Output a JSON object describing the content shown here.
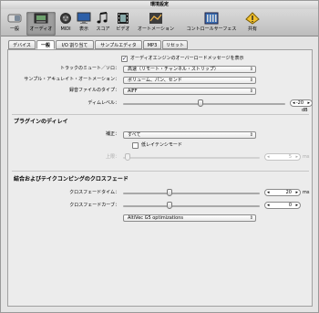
{
  "window": {
    "title": "環境設定"
  },
  "toolbar": {
    "items": [
      {
        "label": "一般",
        "icon": "switch-icon"
      },
      {
        "label": "オーディオ",
        "icon": "audio-interface-icon"
      },
      {
        "label": "MIDI",
        "icon": "midi-port-icon"
      },
      {
        "label": "表示",
        "icon": "display-icon"
      },
      {
        "label": "スコア",
        "icon": "notes-icon"
      },
      {
        "label": "ビデオ",
        "icon": "film-icon"
      },
      {
        "label": "オートメーション",
        "icon": "automation-icon"
      },
      {
        "label": "コントロールサーフェス",
        "icon": "control-surface-icon"
      },
      {
        "label": "共有",
        "icon": "warning-icon"
      }
    ]
  },
  "tabs": [
    "デバイス",
    "一般",
    "I/O 割り当て",
    "サンプルエディタ",
    "MP3",
    "リセット"
  ],
  "general": {
    "overload_label": "オーディオエンジンのオーバーロードメッセージを表示",
    "track_mute_label": "トラックのミュート／ソロ：",
    "track_mute_value": "高速（リモート・チャンネル・ストリップ）",
    "sample_auto_label": "サンプル・アキュレイト・オートメーション：",
    "sample_auto_value": "ボリューム、パン、センド",
    "rec_type_label": "録音ファイルのタイプ：",
    "rec_type_value": "AIFF",
    "dim_label": "ディムレベル：",
    "dim_value": "-20",
    "dim_unit": "dB"
  },
  "plugin_delay": {
    "title": "プラグインのディレイ",
    "comp_label": "補正：",
    "comp_value": "すべて",
    "low_latency_label": "低レイテンシモード",
    "limit_label": "上限：",
    "limit_value": "5",
    "limit_unit": "ms"
  },
  "crossfade": {
    "title": "結合およびテイクコンピングのクロスフェード",
    "time_label": "クロスフェードタイム：",
    "time_value": "20",
    "time_unit": "ms",
    "curve_label": "クロスフェードカーブ：",
    "curve_value": "0",
    "optim_value": "AltiVec G5 optimizations"
  }
}
